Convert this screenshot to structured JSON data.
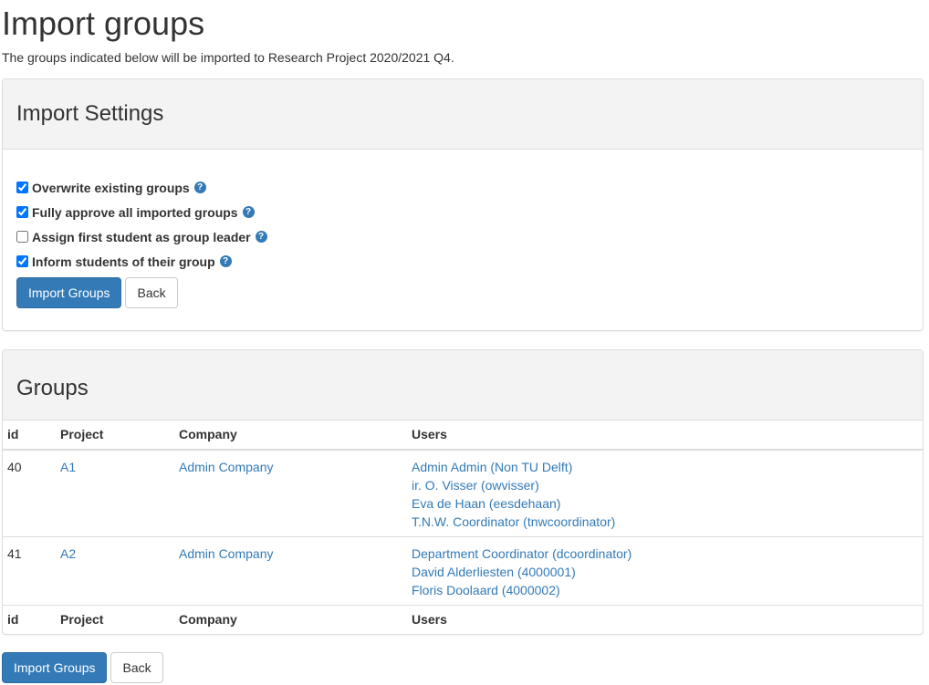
{
  "page": {
    "title": "Import groups",
    "intro": "The groups indicated below will be imported to Research Project 2020/2021 Q4."
  },
  "settings": {
    "heading": "Import Settings",
    "options": [
      {
        "label": "Overwrite existing groups",
        "checked": true
      },
      {
        "label": "Fully approve all imported groups",
        "checked": true
      },
      {
        "label": "Assign first student as group leader",
        "checked": false
      },
      {
        "label": "Inform students of their group",
        "checked": true
      }
    ],
    "help_glyph": "?",
    "import_button": "Import Groups",
    "back_button": "Back"
  },
  "groups": {
    "heading": "Groups",
    "columns": [
      "id",
      "Project",
      "Company",
      "Users"
    ],
    "rows": [
      {
        "id": "40",
        "project": "A1",
        "company": "Admin Company",
        "users": [
          "Admin Admin (Non TU Delft)",
          "ir. O. Visser (owvisser)",
          "Eva de Haan (eesdehaan)",
          "T.N.W. Coordinator (tnwcoordinator)"
        ]
      },
      {
        "id": "41",
        "project": "A2",
        "company": "Admin Company",
        "users": [
          "Department Coordinator (dcoordinator)",
          "David Alderliesten (4000001)",
          "Floris Doolaard (4000002)"
        ]
      }
    ]
  },
  "footer": {
    "import_button": "Import Groups",
    "back_button": "Back"
  },
  "colors": {
    "primary": "#337ab7",
    "link": "#337ab7",
    "panel_heading_bg": "#f3f3f3"
  }
}
